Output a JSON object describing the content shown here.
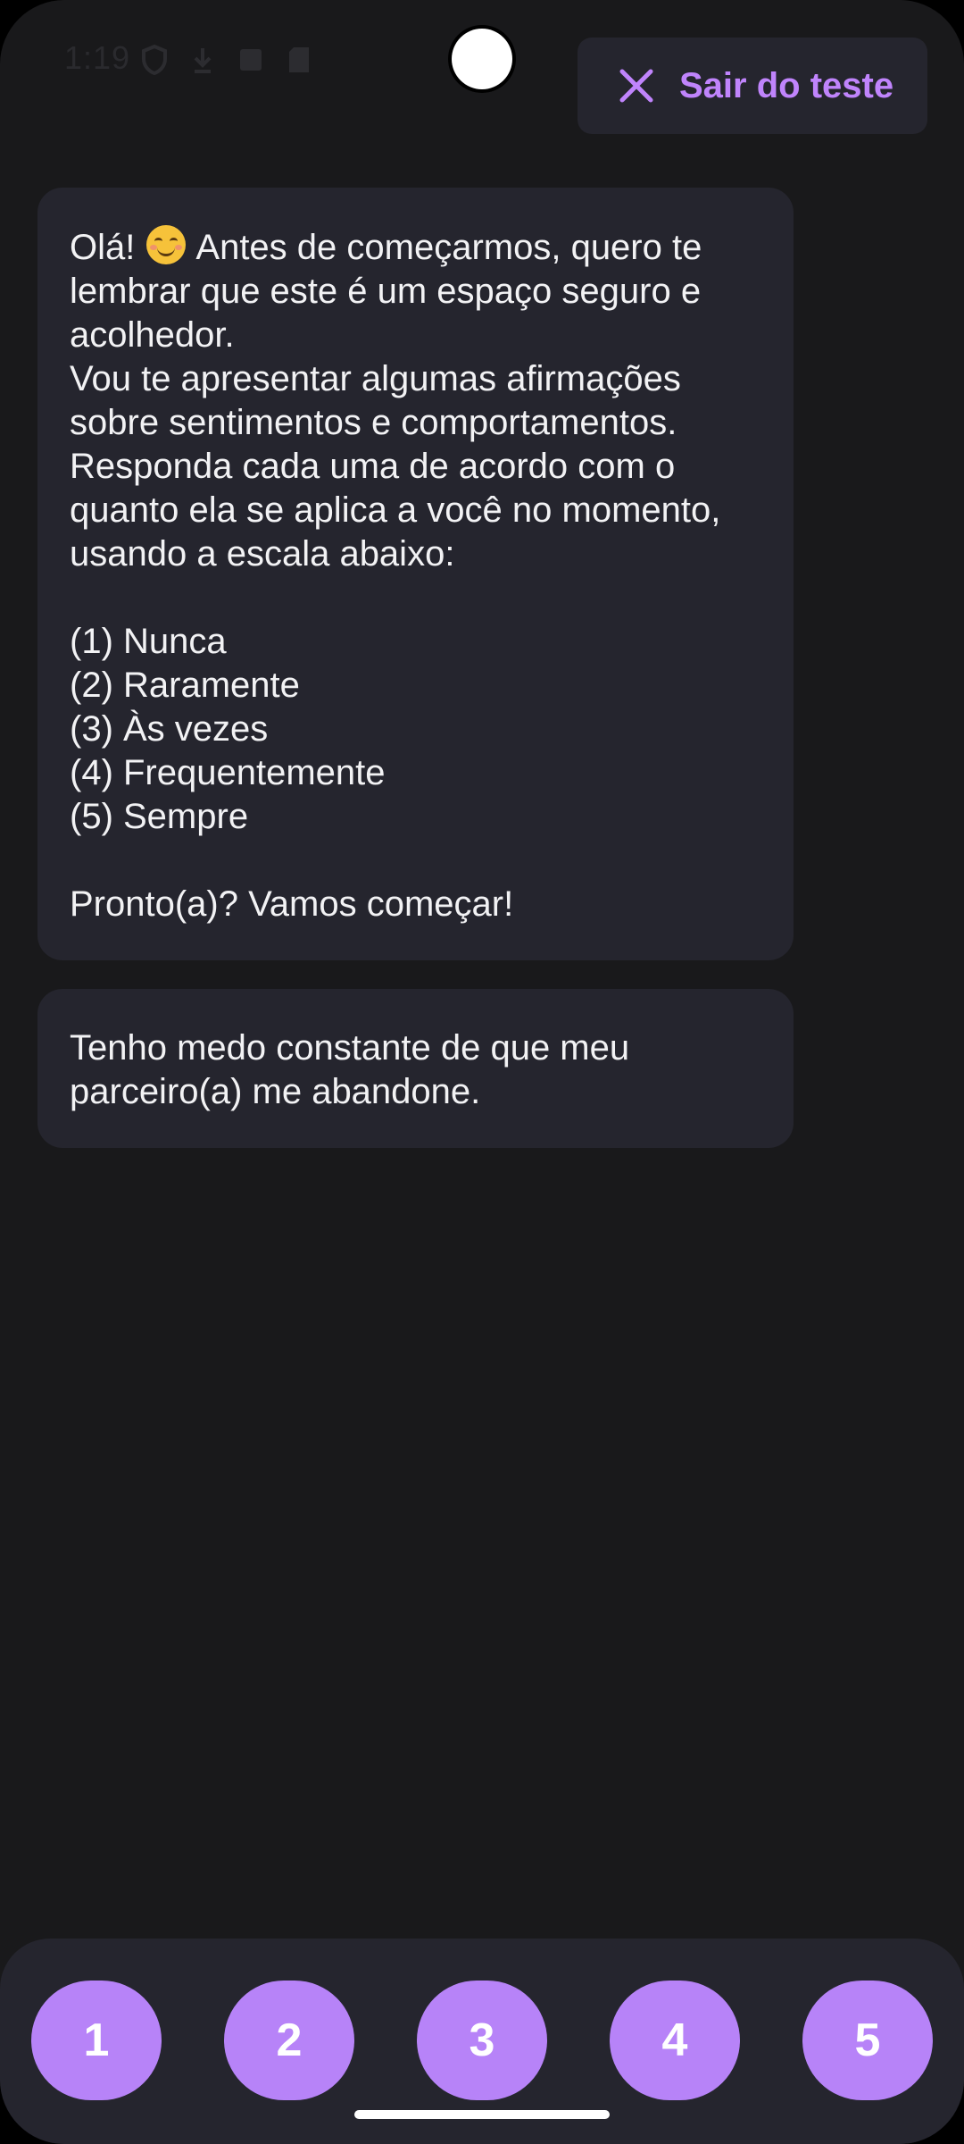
{
  "status_bar": {
    "time": "1:19"
  },
  "header": {
    "exit_label": "Sair do teste",
    "exit_icon": "close-icon"
  },
  "messages": [
    {
      "lines": [
        "Olá! ",
        "lembrar que este é um espaço seguro e",
        "acolhedor.",
        "Vou te apresentar algumas afirmações",
        "sobre sentimentos e comportamentos.",
        "Responda cada uma de acordo com o",
        "quanto ela se aplica a você no momento,",
        "usando a escala abaixo:",
        "",
        "(1) Nunca",
        "(2) Raramente",
        "(3) Às vezes",
        "(4) Frequentemente",
        "(5) Sempre",
        "",
        "Pronto(a)? Vamos começar!"
      ],
      "first_line_after_emoji": " Antes de começarmos, quero te",
      "emoji": "smiling-face-emoji"
    },
    {
      "lines": [
        "Tenho medo constante de que meu",
        "parceiro(a) me abandone."
      ]
    }
  ],
  "answers": [
    "1",
    "2",
    "3",
    "4",
    "5"
  ],
  "colors": {
    "background": "#19191b",
    "bubble": "#25252e",
    "accent": "#c084fc",
    "answer_button": "#b783f8"
  }
}
